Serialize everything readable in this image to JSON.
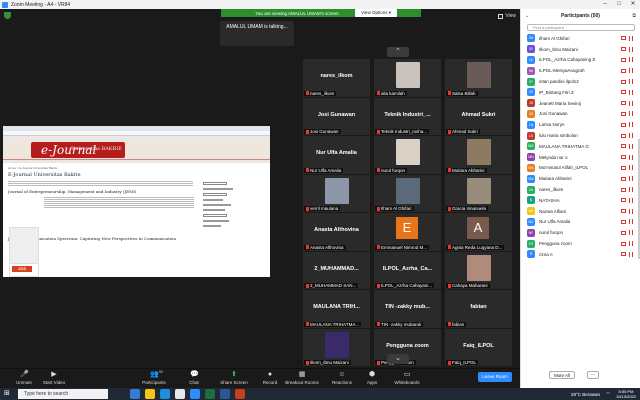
{
  "window": {
    "title": "Zoom Meeting - A4 - VR84",
    "controls": [
      "–",
      "□",
      "✕"
    ]
  },
  "banner": {
    "viewing_text": "You are viewing AMALUL UMAM's screen",
    "view_options": "View Options ▾"
  },
  "talking": "AMALUL UMAM is talking...",
  "view_label": "View",
  "shared_screen": {
    "logo_text": "e-Journal",
    "logo_sub": "Universitas BAKRIE",
    "breadcrumb": "Home > E-Journal Universitas Bakrie",
    "heading": "E-Journal Universitas Bakrie",
    "journal1_title": "Journal of Entrepreneurship, Management and Industry (JEMI)",
    "journal2_title": "Journal Communication Spectrum: Capturing New Perspectives in Communication",
    "journal2_badge": "JCS"
  },
  "gallery": {
    "tiles": [
      {
        "name": "nares_ilkom",
        "label": "nares_ilkom",
        "kind": "name"
      },
      {
        "name": "",
        "label": "alia kamilah",
        "kind": "photo",
        "color": "#c9c2bd"
      },
      {
        "name": "",
        "label": "Salsa Billah",
        "kind": "photo",
        "color": "#6a5a58"
      },
      {
        "name": "Josi Gunawan",
        "label": "Josi Gunawan",
        "kind": "name"
      },
      {
        "name": "Teknik Industri_...",
        "label": "Teknik Industri_Iosha...",
        "kind": "name"
      },
      {
        "name": "Ahmad Sukri",
        "label": "Ahmad Sukri",
        "kind": "name"
      },
      {
        "name": "Nur Ulfa Amalia",
        "label": "Nur Ulfa Amalia",
        "kind": "name"
      },
      {
        "name": "",
        "label": "nurul furqon",
        "kind": "photo",
        "color": "#d9d2c4"
      },
      {
        "name": "",
        "label": "Mutiara Abharini",
        "kind": "photo",
        "color": "#8c7a62"
      },
      {
        "name": "",
        "label": "verril maulana",
        "kind": "photo",
        "color": "#8c96a8"
      },
      {
        "name": "",
        "label": "Ilham Al Ghifari",
        "kind": "photo",
        "color": "#5a6a7a"
      },
      {
        "name": "",
        "label": "Gracia Iimanuela",
        "kind": "photo",
        "color": "#9a8c7a"
      },
      {
        "name": "Anasta Althovina",
        "label": "Anasta Althovina",
        "kind": "name"
      },
      {
        "name": "E",
        "label": "Emmanuel Nimrod M...",
        "kind": "letter",
        "color": "#e8751a"
      },
      {
        "name": "A",
        "label": "Agnia Reda Luqyana D...",
        "kind": "letter",
        "color": "#7a5a4a"
      },
      {
        "name": "2_MUHAMMAD...",
        "label": "2_MUHAMMAD SAN...",
        "kind": "name"
      },
      {
        "name": "ILPOL_Azrha_Ca...",
        "label": "ILPOL_Azrha Cahayani...",
        "kind": "name"
      },
      {
        "name": "",
        "label": "Cahaya Maharani",
        "kind": "photo",
        "color": "#b08a7a"
      },
      {
        "name": "MAULANA TRIH...",
        "label": "MAULANA TRIHATMA...",
        "kind": "name"
      },
      {
        "name": "TIN -zakky mub...",
        "label": "TIN -zakky mubarok",
        "kind": "name"
      },
      {
        "name": "fabian",
        "label": "fabian",
        "kind": "name"
      },
      {
        "name": "",
        "label": "Ilkom_Ibnu Maizani",
        "kind": "photo",
        "color": "#3a2a6a"
      },
      {
        "name": "Pengguna zoom",
        "label": "Pengguna zoom",
        "kind": "name"
      },
      {
        "name": "Faiq_ILPOL",
        "label": "Faiq_ILPOL",
        "kind": "name"
      }
    ]
  },
  "toolbar": {
    "items": [
      {
        "label": "Unmute",
        "icon": "🎤",
        "name": "unmute-button"
      },
      {
        "label": "Start Video",
        "icon": "▶",
        "name": "start-video-button"
      },
      {
        "label": "Participants",
        "icon": "👥",
        "name": "participants-button",
        "count": "50"
      },
      {
        "label": "Chat",
        "icon": "💬",
        "name": "chat-button"
      },
      {
        "label": "Share Screen",
        "icon": "⬆",
        "name": "share-screen-button"
      },
      {
        "label": "Record",
        "icon": "●",
        "name": "record-button"
      },
      {
        "label": "Breakout Rooms",
        "icon": "▦",
        "name": "breakout-rooms-button"
      },
      {
        "label": "Reactions",
        "icon": "☺",
        "name": "reactions-button"
      },
      {
        "label": "Apps",
        "icon": "⬢",
        "name": "apps-button"
      },
      {
        "label": "Whiteboards",
        "icon": "▭",
        "name": "whiteboards-button"
      }
    ],
    "leave_label": "Leave Room"
  },
  "participants": {
    "title": "Participants (50)",
    "find_placeholder": "Find a participant",
    "list": [
      {
        "initials": "IM",
        "name": "Ilham Al Ghifari",
        "color": "#2d8cff"
      },
      {
        "initials": "IB",
        "name": "Ilkom_Ibnu Maizani",
        "color": "#6b4fd8"
      },
      {
        "initials": "IA",
        "name": "ILPOL_Azrha Cahayaning E",
        "color": "#2d8cff"
      },
      {
        "initials": "IM",
        "name": "ILPOL-MeisyaAnugrah",
        "color": "#9b59b6"
      },
      {
        "initials": "IP",
        "name": "intan pandini ilpol12",
        "color": "#27ae60"
      },
      {
        "initials": "IB",
        "name": "IP_Bintang Fitri Z",
        "color": "#2d8cff"
      },
      {
        "initials": "JS",
        "name": "Jeanett Maria Sevinij",
        "color": "#c0392b"
      },
      {
        "initials": "JG",
        "name": "Josi Gunawan",
        "color": "#e67e22"
      },
      {
        "initials": "LN",
        "name": "Larisa Noryn",
        "color": "#2d8cff"
      },
      {
        "initials": "LS",
        "name": "lulu maria simbolon",
        "color": "#c0392b"
      },
      {
        "initials": "MG",
        "name": "MAULANA TRIHATMA G",
        "color": "#27ae60"
      },
      {
        "initials": "MN",
        "name": "Melynda nur o",
        "color": "#8e44ad"
      },
      {
        "initials": "MA",
        "name": "Mu'minatul Alifah_ILPOL",
        "color": "#e67e22"
      },
      {
        "initials": "MA",
        "name": "Mutiara Abharini",
        "color": "#2d8cff"
      },
      {
        "initials": "NI",
        "name": "nares_ilkom",
        "color": "#27ae60"
      },
      {
        "initials": "N",
        "name": "NATASHA",
        "color": "#16a085"
      },
      {
        "initials": "NA",
        "name": "Nazwa Alfiani",
        "color": "#f1c40f"
      },
      {
        "initials": "NU",
        "name": "Nur Ulfa Amalia",
        "color": "#2d8cff"
      },
      {
        "initials": "NF",
        "name": "nurul furqon",
        "color": "#8e44ad"
      },
      {
        "initials": "PZ",
        "name": "Pengguna zoom",
        "color": "#27ae60"
      },
      {
        "initials": "R",
        "name": "rizna n",
        "color": "#2d8cff"
      }
    ],
    "mute_all": "Mute All",
    "more": "..."
  },
  "taskbar": {
    "search_placeholder": "Type here to search",
    "weather": "28°C Berawan",
    "time": "8:55 PM",
    "date": "10/13/2022"
  }
}
